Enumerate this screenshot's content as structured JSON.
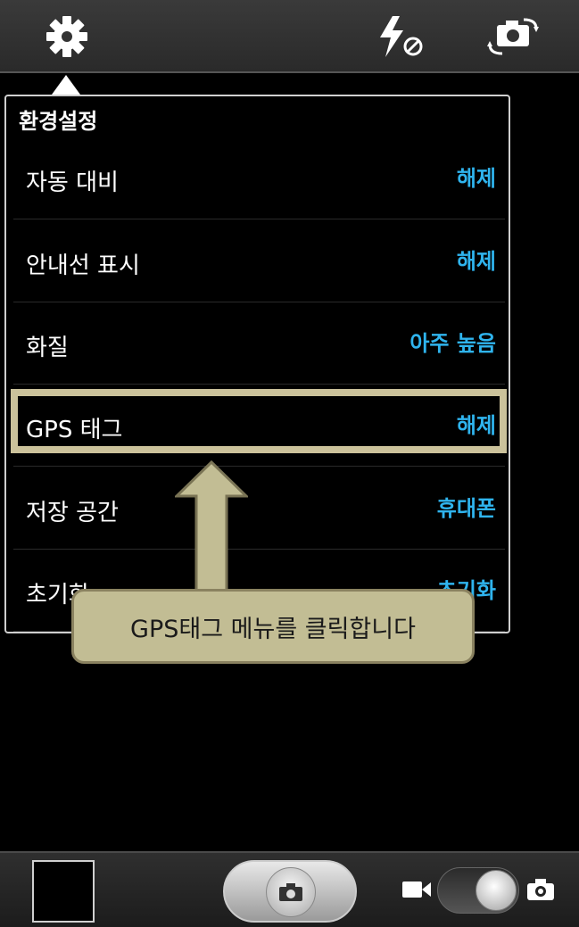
{
  "topbar": {
    "icons": [
      "gear-icon",
      "flash-off-icon",
      "switch-camera-icon"
    ]
  },
  "panel": {
    "title": "환경설정",
    "rows": [
      {
        "label": "자동 대비",
        "value": "해제"
      },
      {
        "label": "안내선 표시",
        "value": "해제"
      },
      {
        "label": "화질",
        "value": "아주 높음"
      },
      {
        "label": "GPS 태그",
        "value": "해제"
      },
      {
        "label": "저장 공간",
        "value": "휴대폰"
      },
      {
        "label": "초기화",
        "value": "초기화"
      }
    ]
  },
  "callout": {
    "text": "GPS태그 메뉴를 클릭합니다"
  },
  "bottombar": {
    "icons": [
      "gallery-thumbnail",
      "shutter-camera-icon",
      "video-camera-icon",
      "mode-toggle",
      "photo-camera-icon"
    ]
  },
  "colors": {
    "value_text": "#2fb4ee",
    "highlight": "#cbc29b",
    "callout_bg": "#c2bd94"
  }
}
